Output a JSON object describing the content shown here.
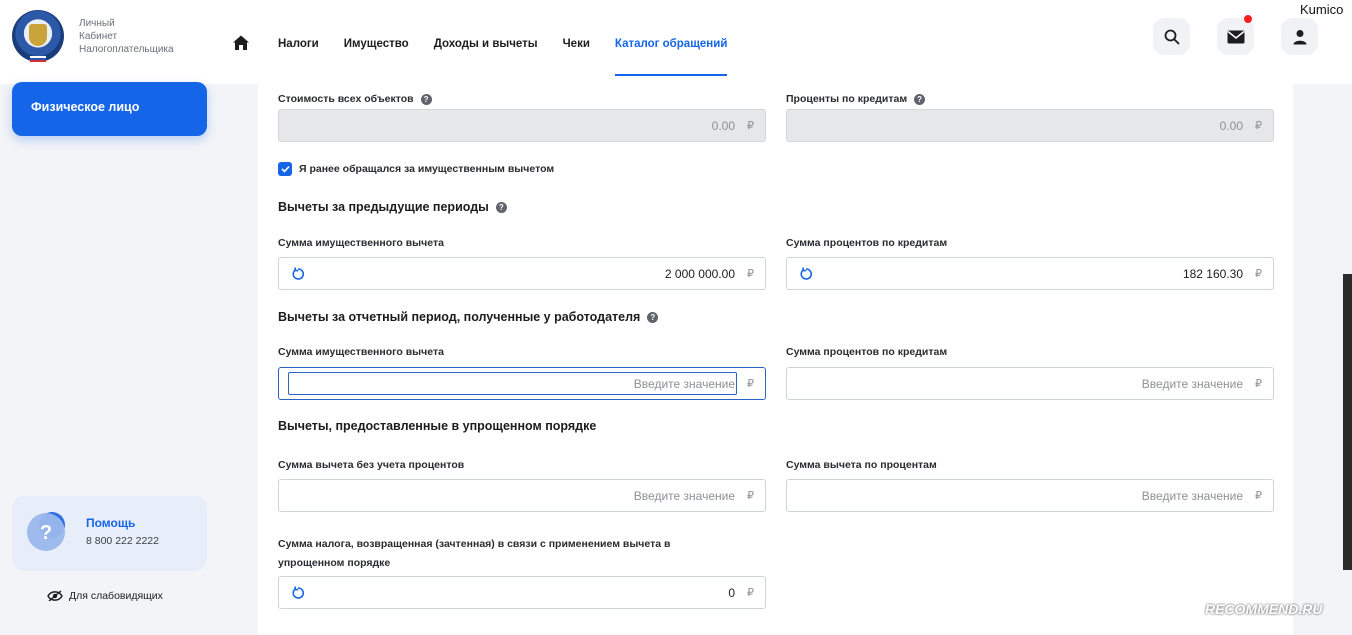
{
  "header": {
    "logo_lines": [
      "Личный",
      "Кабинет",
      "Налогоплательщика"
    ],
    "nav": [
      {
        "label": "Налоги"
      },
      {
        "label": "Имущество"
      },
      {
        "label": "Доходы и вычеты"
      },
      {
        "label": "Чеки"
      },
      {
        "label": "Каталог обращений",
        "active": true
      }
    ],
    "icons": [
      "home-icon",
      "search-icon",
      "mail-icon",
      "user-icon"
    ],
    "watermark": "Kumico"
  },
  "sidebar": {
    "role_button": "Физическое лицо",
    "help_title": "Помощь",
    "help_phone": "8 800 222 2222",
    "accessibility": "Для слабовидящих"
  },
  "form": {
    "total_cost_label": "Стоимость всех объектов",
    "total_cost_value": "0.00",
    "loan_interest_label": "Проценты по кредитам",
    "loan_interest_value": "0.00",
    "checkbox_label": "Я ранее обращался за имущественным вычетом",
    "checkbox_checked": true,
    "section_prev": "Вычеты за предыдущие периоды",
    "prev_property_label": "Сумма имущественного вычета",
    "prev_property_value": "2 000 000.00",
    "prev_interest_label": "Сумма процентов по кредитам",
    "prev_interest_value": "182 160.30",
    "section_employer": "Вычеты за отчетный период, полученные у работодателя",
    "emp_property_label": "Сумма имущественного вычета",
    "emp_property_placeholder": "Введите значение",
    "emp_interest_label": "Сумма процентов по кредитам",
    "emp_interest_placeholder": "Введите значение",
    "section_simplified": "Вычеты, предоставленные в упрощенном порядке",
    "simp_nointerest_label": "Сумма вычета без учета процентов",
    "simp_nointerest_placeholder": "Введите значение",
    "simp_interest_label": "Сумма вычета по процентам",
    "simp_interest_placeholder": "Введите значение",
    "tax_returned_label_line1": "Сумма налога, возвращенная (зачтенная) в связи с применением вычета в",
    "tax_returned_label_line2": "упрощенном порядке",
    "tax_returned_value": "0",
    "currency": "₽"
  },
  "footer_watermark": "RECOMMEND.RU",
  "colors": {
    "accent": "#1565e8",
    "notification": "#ff1e1e"
  }
}
